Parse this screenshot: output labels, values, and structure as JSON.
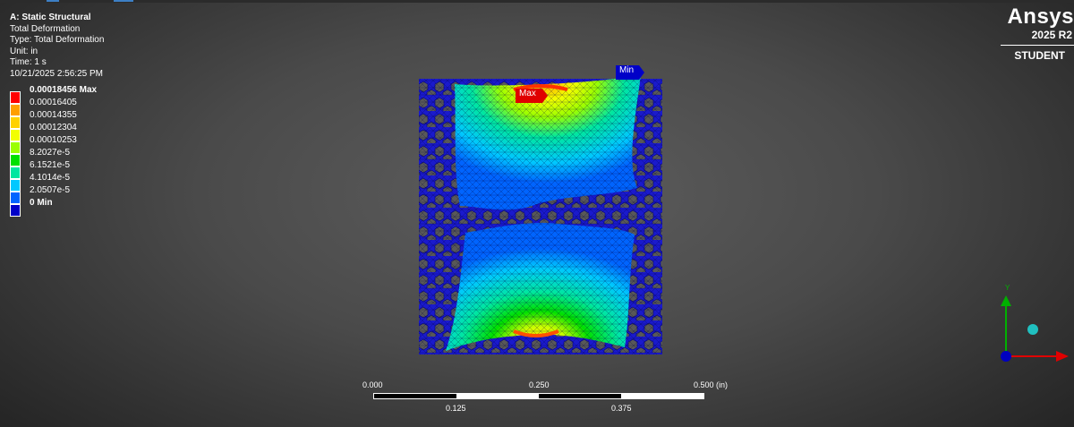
{
  "header": {
    "title": "A: Static Structural",
    "result_name": "Total Deformation",
    "type_line": "Type: Total Deformation",
    "unit_line": "Unit: in",
    "time_line": "Time: 1 s",
    "timestamp": "10/21/2025 2:56:25 PM"
  },
  "legend": {
    "entries": [
      {
        "label": "0.00018456 Max",
        "color": "#ff0000",
        "bold": true
      },
      {
        "label": "0.00016405",
        "color": "#ff9f00",
        "bold": false
      },
      {
        "label": "0.00014355",
        "color": "#ffd200",
        "bold": false
      },
      {
        "label": "0.00012304",
        "color": "#f2ff00",
        "bold": false
      },
      {
        "label": "0.00010253",
        "color": "#9bff00",
        "bold": false
      },
      {
        "label": "8.2027e-5",
        "color": "#00e000",
        "bold": false
      },
      {
        "label": "6.1521e-5",
        "color": "#00e6a0",
        "bold": false
      },
      {
        "label": "4.1014e-5",
        "color": "#00c8ff",
        "bold": false
      },
      {
        "label": "2.0507e-5",
        "color": "#0064ff",
        "bold": false
      },
      {
        "label": "0 Min",
        "color": "#0000c8",
        "bold": true
      }
    ]
  },
  "branding": {
    "logo": "Ansys",
    "version": "2025 R2",
    "edition": "STUDENT"
  },
  "probes": {
    "max_label": "Max",
    "min_label": "Min",
    "max_color": "#e00000",
    "min_color": "#0000c8"
  },
  "scale_bar": {
    "top_labels": [
      "0.000",
      "0.250",
      "0.500 (in)"
    ],
    "bottom_labels": [
      "0.125",
      "0.375"
    ]
  },
  "triad": {
    "y_label": "Y",
    "y_color": "#00b000",
    "x_color": "#e00000",
    "z_color": "#0000c0",
    "ball_color": "#20c0c0"
  }
}
